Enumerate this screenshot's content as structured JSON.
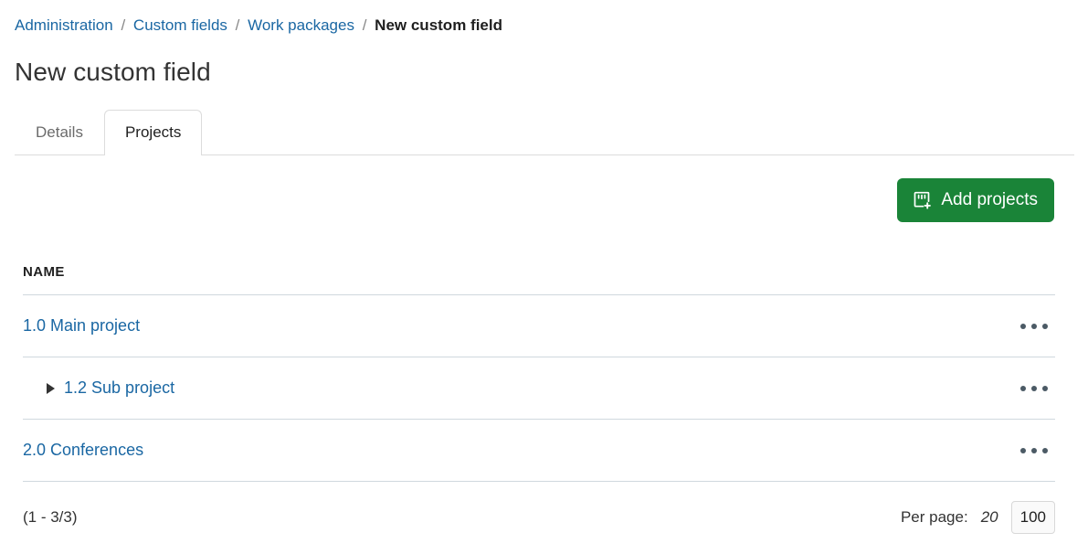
{
  "breadcrumb": {
    "separator": "/",
    "items": [
      {
        "label": "Administration",
        "current": false
      },
      {
        "label": "Custom fields",
        "current": false
      },
      {
        "label": "Work packages",
        "current": false
      },
      {
        "label": "New custom field",
        "current": true
      }
    ]
  },
  "page": {
    "title": "New custom field"
  },
  "tabs": [
    {
      "label": "Details",
      "active": false
    },
    {
      "label": "Projects",
      "active": true
    }
  ],
  "toolbar": {
    "add_projects_label": "Add projects",
    "add_projects_icon": "add-project-icon",
    "accent_green": "#1A8438"
  },
  "table": {
    "columns": [
      "NAME"
    ],
    "rows": [
      {
        "name": "1.0 Main project",
        "indent": 0,
        "has_hierarchy_arrow": false,
        "actions_icon": "more-horizontal-icon"
      },
      {
        "name": "1.2 Sub project",
        "indent": 1,
        "has_hierarchy_arrow": true,
        "actions_icon": "more-horizontal-icon"
      },
      {
        "name": "2.0 Conferences",
        "indent": 0,
        "has_hierarchy_arrow": false,
        "actions_icon": "more-horizontal-icon"
      }
    ]
  },
  "pagination": {
    "range": "(1 - 3/3)",
    "per_page_label": "Per page:",
    "options": [
      {
        "label": "20",
        "selected": false
      },
      {
        "label": "100",
        "selected": true
      }
    ]
  },
  "colors": {
    "link_blue": "#1A67A3",
    "text_dark": "#333333",
    "border_grey": "#d0d8de"
  }
}
